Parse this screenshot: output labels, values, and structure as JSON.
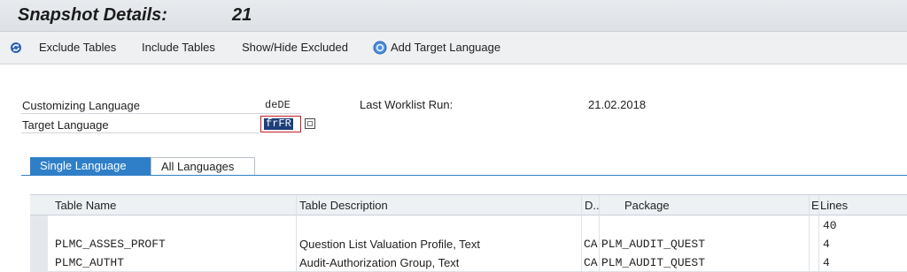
{
  "header": {
    "title": "Snapshot Details:",
    "snapshot_id": "21"
  },
  "toolbar": {
    "refresh_icon": "refresh-icon",
    "exclude_tables": "Exclude Tables",
    "include_tables": "Include Tables",
    "show_hide_excluded": "Show/Hide Excluded",
    "add_target_language": "Add Target Language"
  },
  "form": {
    "customizing_language_label": "Customizing Language",
    "customizing_language_value": "deDE",
    "target_language_label": "Target Language",
    "target_language_value": "frFR",
    "last_worklist_label": "Last Worklist Run:",
    "last_worklist_value": "21.02.2018"
  },
  "tabs": {
    "single": "Single Language",
    "all": "All Languages"
  },
  "grid": {
    "columns": [
      "Table Name",
      "Table Description",
      "D..",
      "Package",
      "E",
      "Lines"
    ],
    "total_lines": "40",
    "rows": [
      {
        "table_name": "PLMC_ASSES_PROFT",
        "description": "Question List Valuation Profile, Text",
        "d": "CA",
        "package": "PLM_AUDIT_QUEST",
        "e": "",
        "lines": "4"
      },
      {
        "table_name": "PLMC_AUTHT",
        "description": "Audit-Authorization Group, Text",
        "d": "CA",
        "package": "PLM_AUDIT_QUEST",
        "e": "",
        "lines": "4"
      }
    ]
  },
  "colors": {
    "tab_active": "#2f7fc8",
    "selection": "#1d3f7a",
    "focus_border": "#c21f2a"
  }
}
